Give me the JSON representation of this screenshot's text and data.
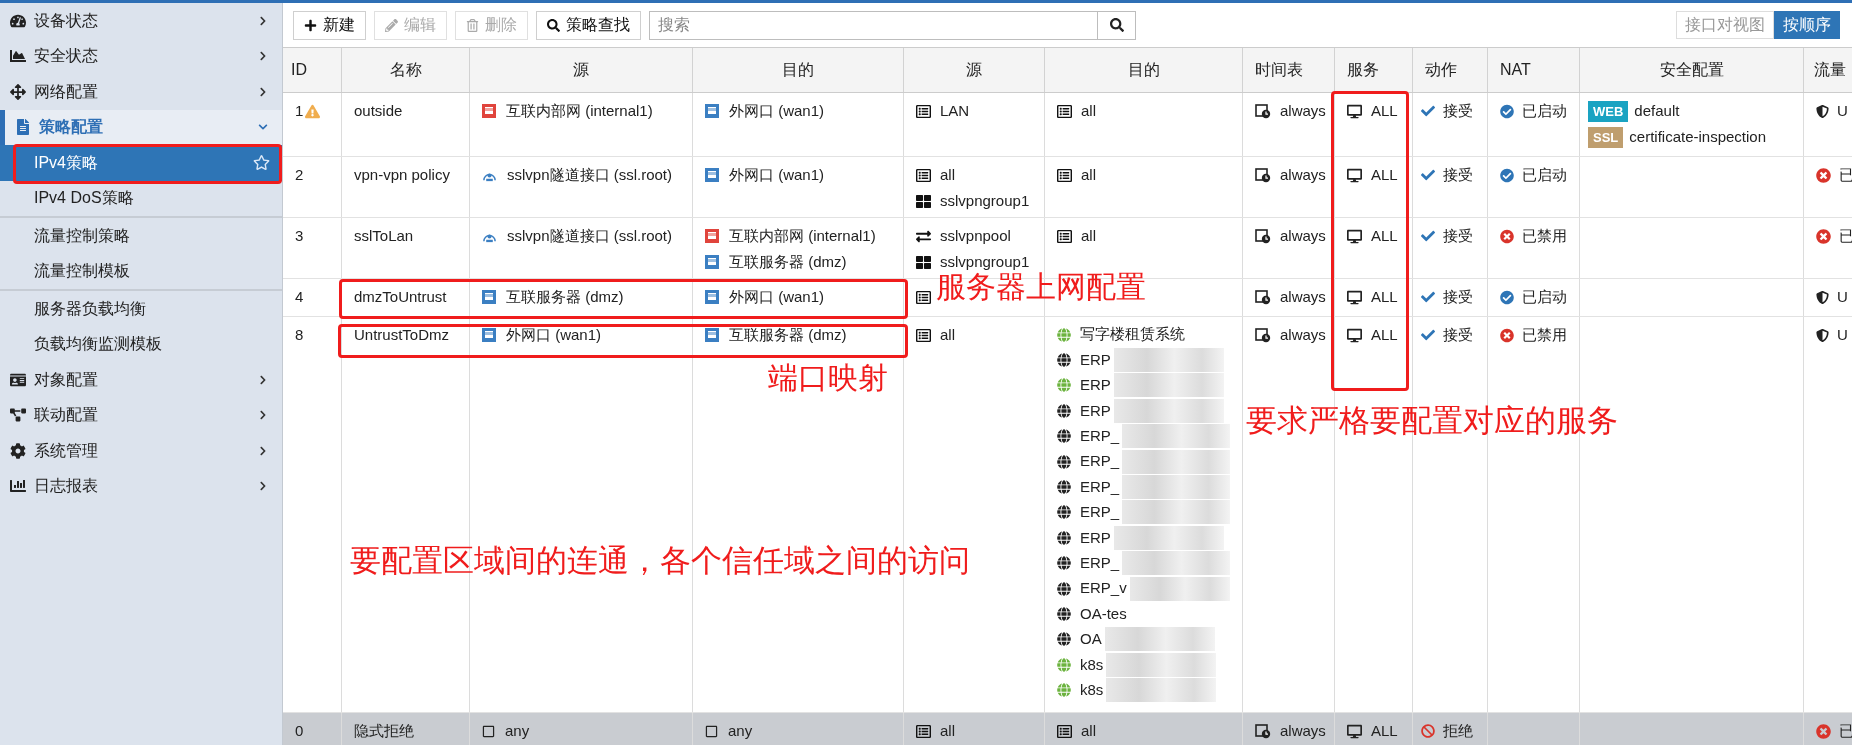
{
  "sidebar": {
    "items": [
      {
        "label": "设备状态",
        "expanded": false
      },
      {
        "label": "安全状态",
        "expanded": false
      },
      {
        "label": "网络配置",
        "expanded": false
      },
      {
        "label": "策略配置",
        "expanded": true,
        "children": [
          {
            "label": "IPv4策略",
            "selected": true
          },
          {
            "label": "IPv4 DoS策略",
            "selected": false
          },
          {
            "label": "流量控制策略",
            "selected": false
          },
          {
            "label": "流量控制模板",
            "selected": false
          },
          {
            "label": "服务器负载均衡",
            "selected": false
          },
          {
            "label": "负载均衡监测模板",
            "selected": false
          }
        ]
      },
      {
        "label": "对象配置",
        "expanded": false
      },
      {
        "label": "联动配置",
        "expanded": false
      },
      {
        "label": "系统管理",
        "expanded": false
      },
      {
        "label": "日志报表",
        "expanded": false
      }
    ]
  },
  "toolbar": {
    "buttons": [
      {
        "label": "新建",
        "kind": "add",
        "disabled": false
      },
      {
        "label": "编辑",
        "kind": "edit",
        "disabled": true
      },
      {
        "label": "删除",
        "kind": "delete",
        "disabled": true
      },
      {
        "label": "策略查找",
        "kind": "find",
        "disabled": false
      }
    ],
    "search": {
      "placeholder": "搜索"
    },
    "views": [
      {
        "label": "接口对视图",
        "selected": false
      },
      {
        "label": "按顺序",
        "selected": true
      }
    ]
  },
  "table": {
    "columns": [
      "ID",
      "名称",
      "源",
      "目的",
      "源",
      "目的",
      "时间表",
      "服务",
      "动作",
      "NAT",
      "安全配置",
      "流量"
    ],
    "rows": [
      {
        "kind": "policy",
        "id": "1",
        "warning": true,
        "name": "outside",
        "src_intf": [
          {
            "kind": "port",
            "color": "#e0443c",
            "text": "互联内部网 (internal1)"
          }
        ],
        "dst_intf": [
          {
            "kind": "port",
            "color": "#3b7fc2",
            "text": "外网口 (wan1)"
          }
        ],
        "src_addr": [
          {
            "kind": "address",
            "text": "LAN"
          }
        ],
        "dst_addr": [
          {
            "kind": "address",
            "text": "all"
          }
        ],
        "schedule": "always",
        "service": "ALL",
        "action": {
          "kind": "accept",
          "text": "接受"
        },
        "nat": {
          "enabled": true,
          "text": "已启动"
        },
        "security": [
          {
            "badge": "WEB",
            "color": "#1aa3c2",
            "text": "default"
          },
          {
            "badge": "SSL",
            "color": "#bf9e6e",
            "text": "certificate-inspection"
          }
        ],
        "log": {
          "kind": "utm",
          "text": "U"
        }
      },
      {
        "kind": "policy",
        "id": "2",
        "warning": false,
        "name": "vpn-vpn policy",
        "src_intf": [
          {
            "kind": "tunnel",
            "text": "sslvpn隧道接口 (ssl.root)"
          }
        ],
        "dst_intf": [
          {
            "kind": "port",
            "color": "#3b7fc2",
            "text": "外网口 (wan1)"
          }
        ],
        "src_addr": [
          {
            "kind": "address",
            "text": "all"
          },
          {
            "kind": "group",
            "text": "sslvpngroup1"
          }
        ],
        "dst_addr": [
          {
            "kind": "address",
            "text": "all"
          }
        ],
        "schedule": "always",
        "service": "ALL",
        "action": {
          "kind": "accept",
          "text": "接受"
        },
        "nat": {
          "enabled": true,
          "text": "已启动"
        },
        "log": {
          "kind": "disabled",
          "text": "已"
        }
      },
      {
        "kind": "policy",
        "id": "3",
        "warning": false,
        "name": "sslToLan",
        "src_intf": [
          {
            "kind": "tunnel",
            "text": "sslvpn隧道接口 (ssl.root)"
          }
        ],
        "dst_intf": [
          {
            "kind": "port",
            "color": "#e0443c",
            "text": "互联内部网 (internal1)"
          },
          {
            "kind": "port",
            "color": "#3b7fc2",
            "text": "互联服务器 (dmz)"
          }
        ],
        "src_addr": [
          {
            "kind": "range",
            "text": "sslvpnpool"
          },
          {
            "kind": "group",
            "text": "sslvpngroup1"
          }
        ],
        "dst_addr": [
          {
            "kind": "address",
            "text": "all"
          }
        ],
        "schedule": "always",
        "service": "ALL",
        "action": {
          "kind": "accept",
          "text": "接受"
        },
        "nat": {
          "enabled": false,
          "text": "已禁用"
        },
        "log": {
          "kind": "disabled",
          "text": "已"
        }
      },
      {
        "kind": "policy",
        "id": "4",
        "warning": false,
        "name": "dmzToUntrust",
        "src_intf": [
          {
            "kind": "port",
            "color": "#3b7fc2",
            "text": "互联服务器 (dmz)"
          }
        ],
        "dst_intf": [
          {
            "kind": "port",
            "color": "#3b7fc2",
            "text": "外网口 (wan1)"
          }
        ],
        "src_addr": [
          {
            "kind": "address"
          }
        ],
        "schedule": "always",
        "service": "ALL",
        "action": {
          "kind": "accept",
          "text": "接受"
        },
        "nat": {
          "enabled": true,
          "text": "已启动"
        },
        "log": {
          "kind": "utm",
          "text": "U"
        }
      },
      {
        "kind": "policy",
        "id": "8",
        "warning": false,
        "name": "UntrustToDmz",
        "src_intf": [
          {
            "kind": "port",
            "color": "#3b7fc2",
            "text": "外网口 (wan1)"
          }
        ],
        "dst_intf": [
          {
            "kind": "port",
            "color": "#3b7fc2",
            "text": "互联服务器 (dmz)"
          }
        ],
        "src_addr": [
          {
            "kind": "address",
            "text": "all"
          }
        ],
        "dst_addr": [
          {
            "kind": "globe",
            "color": "#6cb33f",
            "text": "写字楼租赁系统",
            "redacted": false
          },
          {
            "kind": "globe",
            "color": "#222222",
            "text": "ERP",
            "redacted": true
          },
          {
            "kind": "globe",
            "color": "#6cb33f",
            "text": "ERP",
            "redacted": true
          },
          {
            "kind": "globe",
            "color": "#222222",
            "text": "ERP",
            "redacted": true
          },
          {
            "kind": "globe",
            "color": "#222222",
            "text": "ERP_",
            "redacted": true
          },
          {
            "kind": "globe",
            "color": "#222222",
            "text": "ERP_",
            "redacted": true
          },
          {
            "kind": "globe",
            "color": "#222222",
            "text": "ERP_",
            "redacted": true
          },
          {
            "kind": "globe",
            "color": "#222222",
            "text": "ERP_",
            "redacted": true
          },
          {
            "kind": "globe",
            "color": "#222222",
            "text": "ERP",
            "redacted": true
          },
          {
            "kind": "globe",
            "color": "#222222",
            "text": "ERP_",
            "redacted": true
          },
          {
            "kind": "globe",
            "color": "#222222",
            "text": "ERP_v",
            "redacted": true
          },
          {
            "kind": "globe",
            "color": "#222222",
            "text": "OA-tes",
            "redacted": false
          },
          {
            "kind": "globe",
            "color": "#222222",
            "text": "OA",
            "redacted": true
          },
          {
            "kind": "globe",
            "color": "#6cb33f",
            "text": "k8s",
            "redacted": true
          },
          {
            "kind": "globe",
            "color": "#6cb33f",
            "text": "k8s",
            "redacted": true
          }
        ],
        "schedule": "always",
        "service": "ALL",
        "action": {
          "kind": "accept",
          "text": "接受"
        },
        "nat": {
          "enabled": false,
          "text": "已禁用"
        },
        "log": {
          "kind": "utm",
          "text": "U"
        }
      },
      {
        "kind": "implicit",
        "id": "0",
        "warning": false,
        "name": "隐式拒绝",
        "src_intf": [
          {
            "kind": "any",
            "text": "any"
          }
        ],
        "dst_intf": [
          {
            "kind": "any",
            "text": "any"
          }
        ],
        "src_addr": [
          {
            "kind": "address",
            "text": "all"
          }
        ],
        "dst_addr": [
          {
            "kind": "address",
            "text": "all"
          }
        ],
        "schedule": "always",
        "service": "ALL",
        "action": {
          "kind": "deny",
          "text": "拒绝"
        },
        "log": {
          "kind": "disabled",
          "text": "已"
        }
      }
    ]
  },
  "annotations": [
    {
      "kind": "box"
    },
    {
      "kind": "box"
    },
    {
      "kind": "text",
      "text": "服务器上网配置"
    },
    {
      "kind": "box"
    },
    {
      "kind": "text",
      "text": "端口映射"
    },
    {
      "kind": "box"
    },
    {
      "kind": "text",
      "text": "要求严格要配置对应的服务"
    },
    {
      "kind": "text",
      "text": "要配置区域间的连通，各个信任域之间的访问"
    }
  ]
}
